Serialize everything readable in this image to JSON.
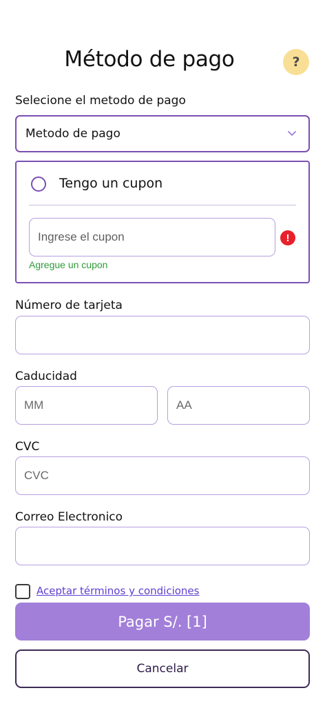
{
  "header": {
    "title": "Método de pago",
    "help_icon": "?"
  },
  "payment_method": {
    "label": "Selecione el metodo de pago",
    "selected": "Metodo de pago"
  },
  "coupon": {
    "title": "Tengo un cupon",
    "placeholder": "Ingrese el cupon",
    "error_icon": "!",
    "hint": "Agregue un cupon"
  },
  "card": {
    "number_label": "Número de tarjeta",
    "number_placeholder": "",
    "expiry_label": "Caducidad",
    "month_placeholder": "MM",
    "year_placeholder": "AA",
    "cvc_label": "CVC",
    "cvc_placeholder": "CVC"
  },
  "email": {
    "label": "Correo Electronico",
    "placeholder": ""
  },
  "terms": {
    "link_text": "Aceptar términos y condiciones"
  },
  "actions": {
    "pay_label": "Pagar S/. [1]",
    "cancel_label": "Cancelar"
  },
  "colors": {
    "accent": "#7b4fb3",
    "pay_button": "#a27fd9",
    "help_bg": "#f9df95",
    "error": "#e8202a",
    "hint": "#2e9c3a"
  }
}
